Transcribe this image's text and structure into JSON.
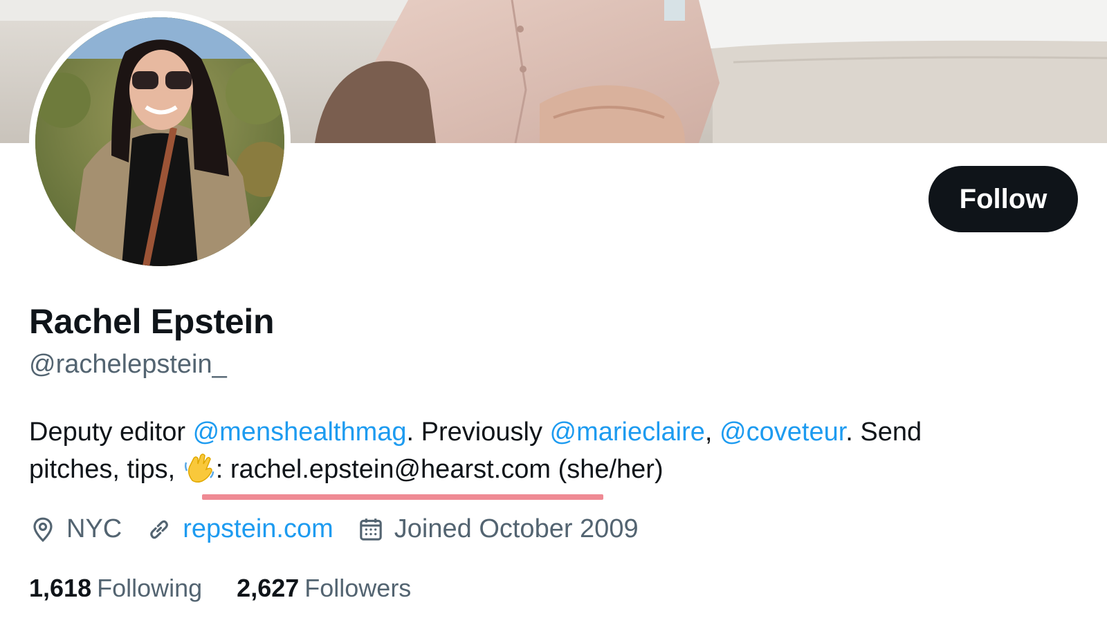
{
  "profile": {
    "name": "Rachel Epstein",
    "handle": "@rachelepstein_",
    "follow_label": "Follow"
  },
  "bio": {
    "part1": "Deputy editor ",
    "mention1": "@menshealthmag",
    "part2": ". Previously ",
    "mention2": "@marieclaire",
    "part3": ", ",
    "mention3": "@coveteur",
    "part4": ". Send",
    "part5": "pitches, tips, ",
    "part6": ": rachel.epstein@hearst.com (she/her)"
  },
  "meta": {
    "location": "NYC",
    "website": "repstein.com",
    "joined": "Joined October 2009"
  },
  "stats": {
    "following_count": "1,618",
    "following_label": "Following",
    "followers_count": "2,627",
    "followers_label": "Followers"
  },
  "colors": {
    "accent": "#1d9bf0",
    "text": "#0f1419",
    "secondary": "#536471",
    "underline": "#ef8a94"
  },
  "icons": {
    "location": "location-pin-icon",
    "link": "link-icon",
    "calendar": "calendar-icon",
    "wave": "waving-hand-emoji"
  }
}
